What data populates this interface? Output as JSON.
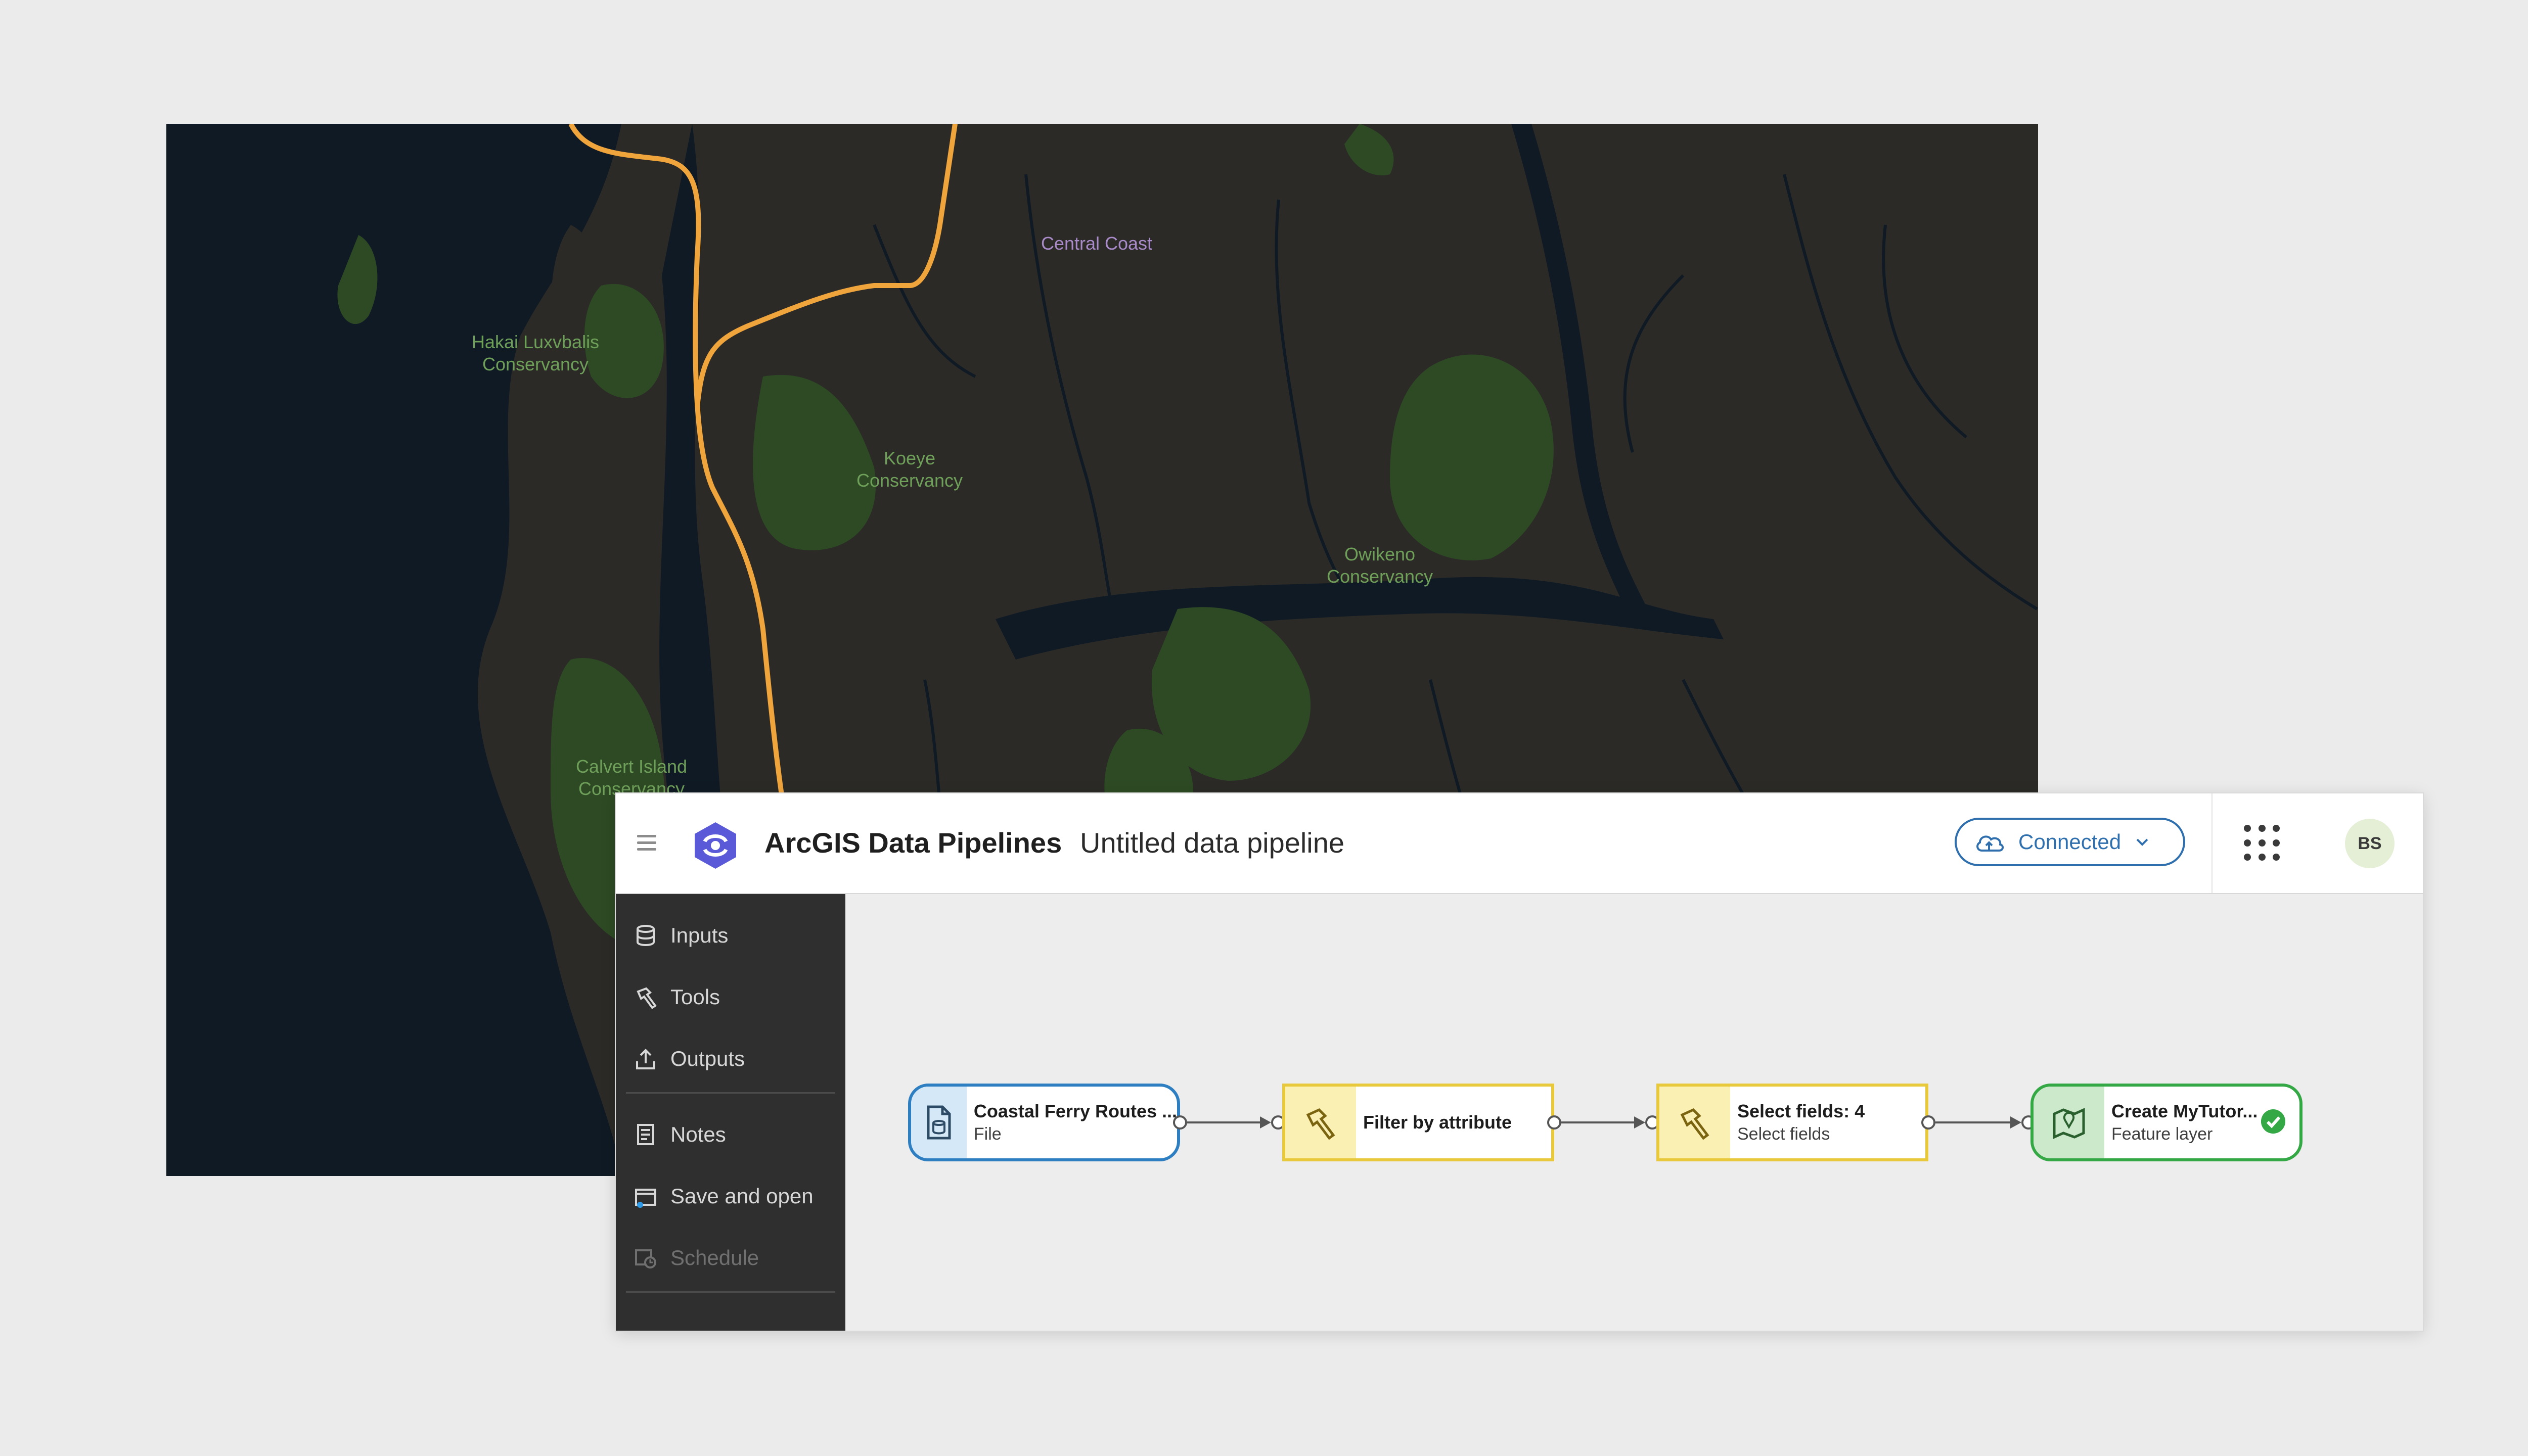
{
  "map": {
    "labels": {
      "hakai": "Hakai Luxvbalis\nConservancy",
      "koeye": "Koeye\nConservancy",
      "owikeno": "Owikeno\nConservancy",
      "calvert": "Calvert Island\nConservancy",
      "central_coast": "Central Coast"
    },
    "colors": {
      "water": "#0f1a24",
      "land": "#2b2a27",
      "park": "#2d4a24",
      "route": "#f0a43c"
    }
  },
  "header": {
    "app_title": "ArcGIS Data Pipelines",
    "document_title": "Untitled data pipeline",
    "connection_status": "Connected",
    "avatar_initials": "BS"
  },
  "sidebar": {
    "items": [
      {
        "label": "Inputs",
        "icon": "database-icon"
      },
      {
        "label": "Tools",
        "icon": "hammer-icon"
      },
      {
        "label": "Outputs",
        "icon": "upload-icon"
      },
      {
        "label": "Notes",
        "icon": "notes-icon"
      },
      {
        "label": "Save and open",
        "icon": "folder-icon"
      },
      {
        "label": "Schedule",
        "icon": "schedule-icon"
      }
    ]
  },
  "pipeline": {
    "nodes": [
      {
        "title": "Coastal Ferry Routes ...",
        "subtitle": "File",
        "kind": "input"
      },
      {
        "title": "Filter by attribute",
        "subtitle": "",
        "kind": "tool"
      },
      {
        "title": "Select fields: 4",
        "subtitle": "Select fields",
        "kind": "tool"
      },
      {
        "title": "Create MyTutor...",
        "subtitle": "Feature layer",
        "kind": "output"
      }
    ]
  },
  "colors": {
    "accent": "#2f6fae",
    "input": "#2d7fc2",
    "tool": "#e8c93c",
    "output": "#33a845",
    "sidebar_bg": "#2f2f2f"
  }
}
